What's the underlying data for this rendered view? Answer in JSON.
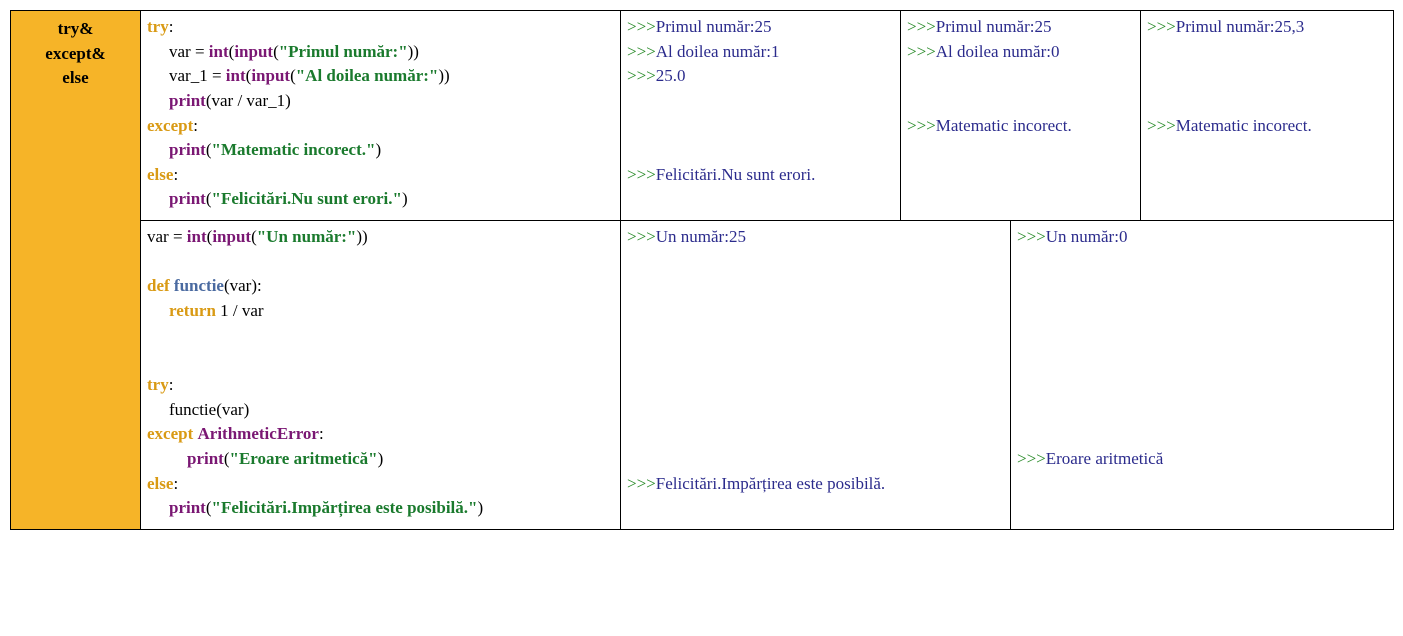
{
  "label": {
    "l1": "try&",
    "l2": "except&",
    "l3": "else"
  },
  "code1": {
    "try": "try",
    "int": "int",
    "input": "input",
    "print": "print",
    "except": "except",
    "else": "else",
    "var_eq": "var = ",
    "var1_eq": "var_1 = ",
    "s_first": "\"Primul număr:\"",
    "s_second": "\"Al doilea număr:\"",
    "div": "(var / var_1)",
    "s_math": "\"Matematic incorect.\"",
    "s_felic": "\"Felicitări.Nu sunt erori.\"",
    "colon": ":"
  },
  "out1a": {
    "p": ">>>",
    "l1": "Primul număr:25",
    "l2": "Al doilea număr:1",
    "l3": "25.0",
    "l4": "Felicitări.Nu sunt erori."
  },
  "out1b": {
    "p": ">>>",
    "l1": "Primul număr:25",
    "l2": "Al doilea număr:0",
    "l3": "Matematic incorect."
  },
  "out1c": {
    "p": ">>>",
    "l1": "Primul număr:25,3",
    "l2": "Matematic incorect."
  },
  "code2": {
    "var_eq": "var = ",
    "int": "int",
    "input": "input",
    "s_un": "\"Un număr:\"",
    "def": "def",
    "funcname": "functie",
    "def_sig": "(var):",
    "return": "return",
    "return_expr": " 1 / var",
    "try": "try",
    "colon": ":",
    "call": "functie(var)",
    "except": "except",
    "arith": "ArithmeticError",
    "print": "print",
    "s_err": "\"Eroare aritmetică\"",
    "else": "else",
    "s_felic2": "\"Felicitări.Impărțirea este posibilă.\""
  },
  "out2a": {
    "p": ">>>",
    "l1": "Un număr:25",
    "l2": "Felicitări.Impărțirea este posibilă."
  },
  "out2b": {
    "p": ">>>",
    "l1": "Un număr:0",
    "l2": "Eroare aritmetică"
  }
}
